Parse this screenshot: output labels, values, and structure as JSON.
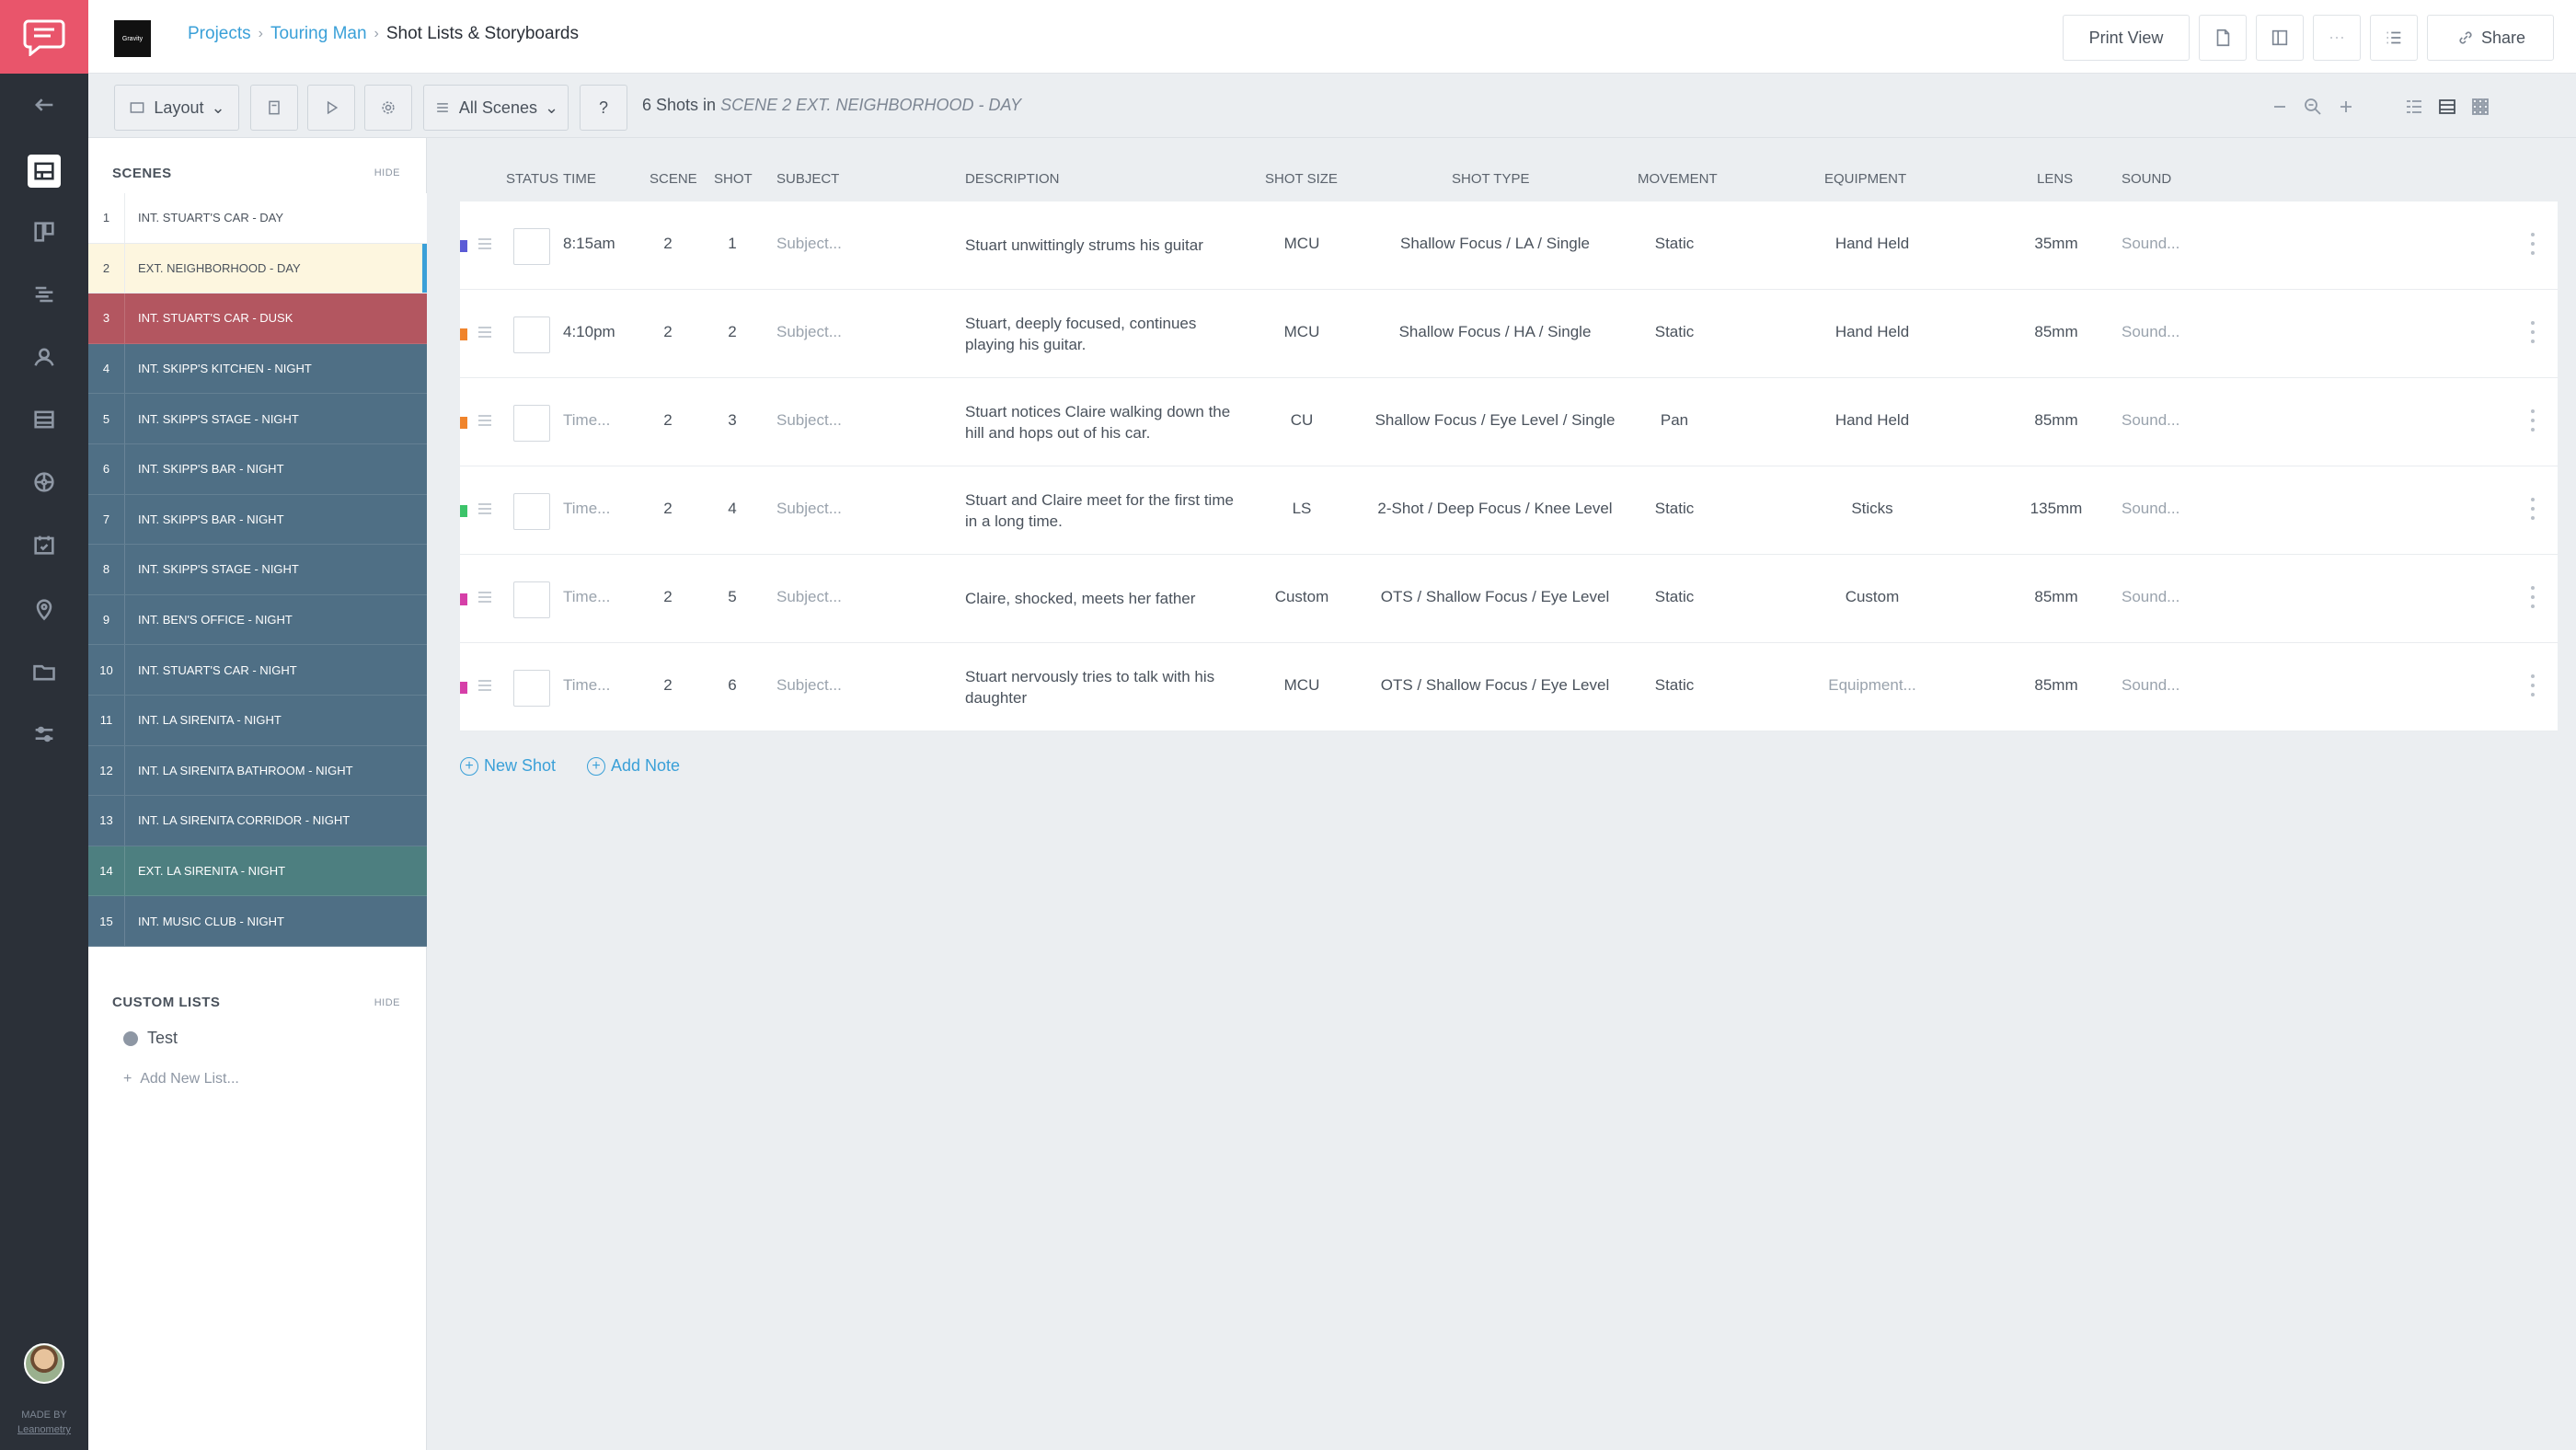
{
  "colors": {
    "accent": "#3aa0d8",
    "brand": "#e9556b",
    "rail": "#2b3038"
  },
  "rail": {
    "items": [
      "chat-bubble-icon",
      "back-arrow-icon",
      "storyboard-icon",
      "board-icon",
      "stripboard-icon",
      "contacts-icon",
      "shotlist-icon",
      "film-reel-icon",
      "calendar-icon",
      "location-icon",
      "folder-icon",
      "settings-sliders-icon"
    ],
    "made_by": "MADE BY",
    "made_by_name": "Leanometry"
  },
  "topbar": {
    "thumb_text": "Gravity",
    "breadcrumb": [
      "Projects",
      "Touring Man",
      "Shot Lists & Storyboards"
    ],
    "print_view": "Print View",
    "share": "Share"
  },
  "toolbar": {
    "layout": "Layout",
    "all_scenes": "All Scenes",
    "help": "?",
    "shot_count_prefix": "6 Shots in",
    "shot_count_scene": "SCENE 2 EXT. NEIGHBORHOOD - DAY"
  },
  "scenes_panel": {
    "title": "SCENES",
    "hide": "HIDE",
    "scenes": [
      {
        "num": "1",
        "name": "INT. STUART'S CAR - DAY",
        "color": "#ffffff",
        "text": "#4a525c"
      },
      {
        "num": "2",
        "name": "EXT. NEIGHBORHOOD - DAY",
        "color": "#fdf6df",
        "text": "#4a525c",
        "active": true
      },
      {
        "num": "3",
        "name": "INT. STUART'S CAR - DUSK",
        "color": "#b35660",
        "text": "#ffffff"
      },
      {
        "num": "4",
        "name": "INT. SKIPP'S KITCHEN - NIGHT",
        "color": "#4f6f85",
        "text": "#ffffff"
      },
      {
        "num": "5",
        "name": "INT. SKIPP'S STAGE - NIGHT",
        "color": "#4f6f85",
        "text": "#ffffff"
      },
      {
        "num": "6",
        "name": "INT. SKIPP'S BAR - NIGHT",
        "color": "#4f6f85",
        "text": "#ffffff"
      },
      {
        "num": "7",
        "name": "INT. SKIPP'S BAR - NIGHT",
        "color": "#4f6f85",
        "text": "#ffffff"
      },
      {
        "num": "8",
        "name": "INT. SKIPP'S STAGE - NIGHT",
        "color": "#4f6f85",
        "text": "#ffffff"
      },
      {
        "num": "9",
        "name": "INT. BEN'S OFFICE - NIGHT",
        "color": "#4f6f85",
        "text": "#ffffff"
      },
      {
        "num": "10",
        "name": "INT. STUART'S CAR - NIGHT",
        "color": "#4f6f85",
        "text": "#ffffff"
      },
      {
        "num": "11",
        "name": "INT. LA SIRENITA - NIGHT",
        "color": "#4f6f85",
        "text": "#ffffff"
      },
      {
        "num": "12",
        "name": "INT. LA SIRENITA BATHROOM - NIGHT",
        "color": "#4f6f85",
        "text": "#ffffff"
      },
      {
        "num": "13",
        "name": "INT. LA SIRENITA CORRIDOR - NIGHT",
        "color": "#4f6f85",
        "text": "#ffffff"
      },
      {
        "num": "14",
        "name": "EXT. LA SIRENITA - NIGHT",
        "color": "#4d7f80",
        "text": "#ffffff"
      },
      {
        "num": "15",
        "name": "INT. MUSIC CLUB - NIGHT",
        "color": "#4f6f85",
        "text": "#ffffff"
      }
    ],
    "custom_title": "CUSTOM LISTS",
    "custom_hide": "HIDE",
    "custom_lists": [
      "Test"
    ],
    "add_list": "Add New List..."
  },
  "table": {
    "headers": [
      "STATUS",
      "TIME",
      "SCENE",
      "SHOT",
      "SUBJECT",
      "DESCRIPTION",
      "SHOT SIZE",
      "SHOT TYPE",
      "MOVEMENT",
      "EQUIPMENT",
      "LENS",
      "SOUND"
    ],
    "rows": [
      {
        "color": "#5b5bd6",
        "time": "8:15am",
        "time_placeholder": false,
        "scene": "2",
        "shot": "1",
        "subject": "Subject...",
        "description": "Stuart unwittingly strums his guitar",
        "size": "MCU",
        "type": "Shallow Focus / LA / Single",
        "movement": "Static",
        "equipment": "Hand Held",
        "equipment_placeholder": false,
        "lens": "35mm",
        "sound": "Sound..."
      },
      {
        "color": "#f0842c",
        "time": "4:10pm",
        "time_placeholder": false,
        "scene": "2",
        "shot": "2",
        "subject": "Subject...",
        "description": "Stuart, deeply focused, continues playing his guitar.",
        "size": "MCU",
        "type": "Shallow Focus / HA / Single",
        "movement": "Static",
        "equipment": "Hand Held",
        "equipment_placeholder": false,
        "lens": "85mm",
        "sound": "Sound..."
      },
      {
        "color": "#f0842c",
        "time": "Time...",
        "time_placeholder": true,
        "scene": "2",
        "shot": "3",
        "subject": "Subject...",
        "description": "Stuart notices Claire walking down the hill and hops out of his car.",
        "size": "CU",
        "type": "Shallow Focus / Eye Level / Single",
        "movement": "Pan",
        "equipment": "Hand Held",
        "equipment_placeholder": false,
        "lens": "85mm",
        "sound": "Sound..."
      },
      {
        "color": "#3cc46a",
        "time": "Time...",
        "time_placeholder": true,
        "scene": "2",
        "shot": "4",
        "subject": "Subject...",
        "description": "Stuart and Claire meet for the first time in a long time.",
        "size": "LS",
        "type": "2-Shot / Deep Focus / Knee Level",
        "movement": "Static",
        "equipment": "Sticks",
        "equipment_placeholder": false,
        "lens": "135mm",
        "sound": "Sound..."
      },
      {
        "color": "#d63fa8",
        "time": "Time...",
        "time_placeholder": true,
        "scene": "2",
        "shot": "5",
        "subject": "Subject...",
        "description": "Claire, shocked, meets her father",
        "size": "Custom",
        "type": "OTS / Shallow Focus / Eye Level",
        "movement": "Static",
        "equipment": "Custom",
        "equipment_placeholder": false,
        "lens": "85mm",
        "sound": "Sound..."
      },
      {
        "color": "#d63fa8",
        "time": "Time...",
        "time_placeholder": true,
        "scene": "2",
        "shot": "6",
        "subject": "Subject...",
        "description": "Stuart nervously tries to talk with his daughter",
        "size": "MCU",
        "type": "OTS / Shallow Focus / Eye Level",
        "movement": "Static",
        "equipment": "Equipment...",
        "equipment_placeholder": true,
        "lens": "85mm",
        "sound": "Sound..."
      }
    ],
    "new_shot": "New Shot",
    "add_note": "Add Note"
  }
}
